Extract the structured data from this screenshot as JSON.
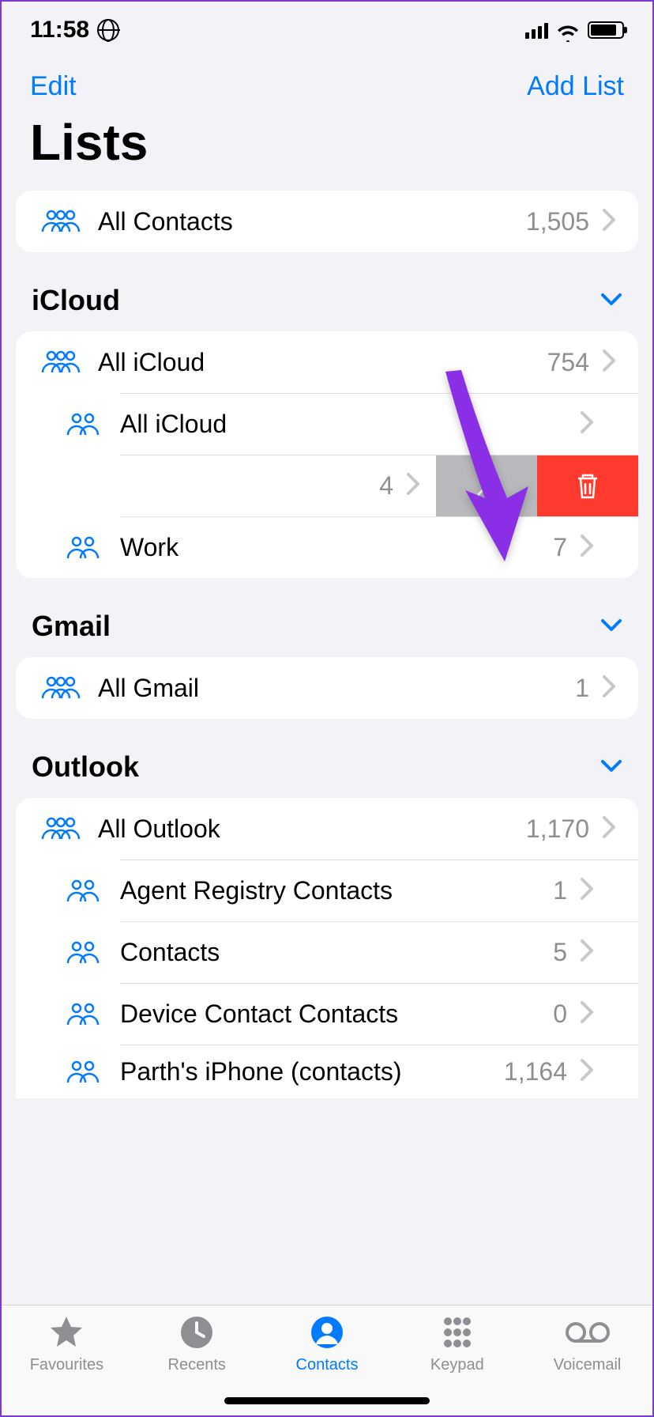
{
  "status": {
    "time": "11:58"
  },
  "nav": {
    "edit": "Edit",
    "add": "Add List"
  },
  "title": "Lists",
  "all_contacts": {
    "label": "All Contacts",
    "count": "1,505"
  },
  "sections": {
    "icloud": {
      "name": "iCloud",
      "rows": [
        {
          "label": "All iCloud",
          "count": "754"
        },
        {
          "label": "All iCloud",
          "count": ""
        }
      ],
      "swiped": {
        "count": "4"
      },
      "work": {
        "label": "Work",
        "count": "7"
      }
    },
    "gmail": {
      "name": "Gmail",
      "rows": [
        {
          "label": "All Gmail",
          "count": "1"
        }
      ]
    },
    "outlook": {
      "name": "Outlook",
      "rows": [
        {
          "label": "All Outlook",
          "count": "1,170"
        },
        {
          "label": "Agent Registry Contacts",
          "count": "1"
        },
        {
          "label": "Contacts",
          "count": "5"
        },
        {
          "label": "Device Contact Contacts",
          "count": "0"
        },
        {
          "label": "Parth's iPhone (contacts)",
          "count": "1,164"
        }
      ]
    }
  },
  "tabs": {
    "favourites": "Favourites",
    "recents": "Recents",
    "contacts": "Contacts",
    "keypad": "Keypad",
    "voicemail": "Voicemail"
  }
}
